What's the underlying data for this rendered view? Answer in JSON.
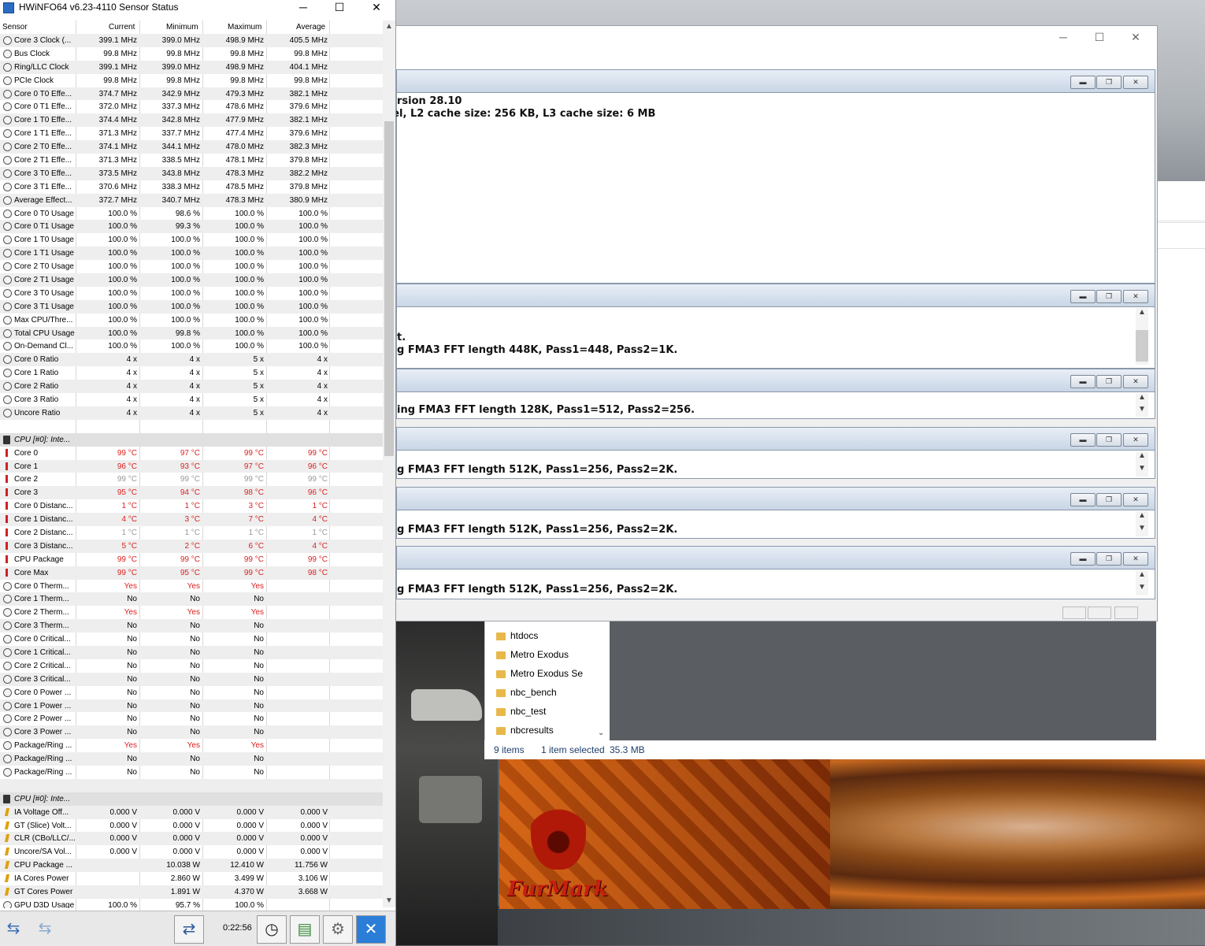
{
  "hwinfo": {
    "title": "HWiNFO64 v6.23-4110 Sensor Status",
    "columns": [
      "Sensor",
      "Current",
      "Minimum",
      "Maximum",
      "Average"
    ],
    "rows": [
      {
        "icon": "clock",
        "name": "Core 3 Clock (...",
        "cur": "399.1 MHz",
        "min": "399.0 MHz",
        "max": "498.9 MHz",
        "avg": "405.5 MHz"
      },
      {
        "icon": "clock",
        "name": "Bus Clock",
        "cur": "99.8 MHz",
        "min": "99.8 MHz",
        "max": "99.8 MHz",
        "avg": "99.8 MHz"
      },
      {
        "icon": "clock",
        "name": "Ring/LLC Clock",
        "cur": "399.1 MHz",
        "min": "399.0 MHz",
        "max": "498.9 MHz",
        "avg": "404.1 MHz"
      },
      {
        "icon": "clock",
        "name": "PCIe Clock",
        "cur": "99.8 MHz",
        "min": "99.8 MHz",
        "max": "99.8 MHz",
        "avg": "99.8 MHz"
      },
      {
        "icon": "clock",
        "name": "Core 0 T0 Effe...",
        "cur": "374.7 MHz",
        "min": "342.9 MHz",
        "max": "479.3 MHz",
        "avg": "382.1 MHz"
      },
      {
        "icon": "clock",
        "name": "Core 0 T1 Effe...",
        "cur": "372.0 MHz",
        "min": "337.3 MHz",
        "max": "478.6 MHz",
        "avg": "379.6 MHz"
      },
      {
        "icon": "clock",
        "name": "Core 1 T0 Effe...",
        "cur": "374.4 MHz",
        "min": "342.8 MHz",
        "max": "477.9 MHz",
        "avg": "382.1 MHz"
      },
      {
        "icon": "clock",
        "name": "Core 1 T1 Effe...",
        "cur": "371.3 MHz",
        "min": "337.7 MHz",
        "max": "477.4 MHz",
        "avg": "379.6 MHz"
      },
      {
        "icon": "clock",
        "name": "Core 2 T0 Effe...",
        "cur": "374.1 MHz",
        "min": "344.1 MHz",
        "max": "478.0 MHz",
        "avg": "382.3 MHz"
      },
      {
        "icon": "clock",
        "name": "Core 2 T1 Effe...",
        "cur": "371.3 MHz",
        "min": "338.5 MHz",
        "max": "478.1 MHz",
        "avg": "379.8 MHz"
      },
      {
        "icon": "clock",
        "name": "Core 3 T0 Effe...",
        "cur": "373.5 MHz",
        "min": "343.8 MHz",
        "max": "478.3 MHz",
        "avg": "382.2 MHz"
      },
      {
        "icon": "clock",
        "name": "Core 3 T1 Effe...",
        "cur": "370.6 MHz",
        "min": "338.3 MHz",
        "max": "478.5 MHz",
        "avg": "379.8 MHz"
      },
      {
        "icon": "clock",
        "name": "Average Effect...",
        "cur": "372.7 MHz",
        "min": "340.7 MHz",
        "max": "478.3 MHz",
        "avg": "380.9 MHz"
      },
      {
        "icon": "clock",
        "name": "Core 0 T0 Usage",
        "cur": "100.0 %",
        "min": "98.6 %",
        "max": "100.0 %",
        "avg": "100.0 %"
      },
      {
        "icon": "clock",
        "name": "Core 0 T1 Usage",
        "cur": "100.0 %",
        "min": "99.3 %",
        "max": "100.0 %",
        "avg": "100.0 %"
      },
      {
        "icon": "clock",
        "name": "Core 1 T0 Usage",
        "cur": "100.0 %",
        "min": "100.0 %",
        "max": "100.0 %",
        "avg": "100.0 %"
      },
      {
        "icon": "clock",
        "name": "Core 1 T1 Usage",
        "cur": "100.0 %",
        "min": "100.0 %",
        "max": "100.0 %",
        "avg": "100.0 %"
      },
      {
        "icon": "clock",
        "name": "Core 2 T0 Usage",
        "cur": "100.0 %",
        "min": "100.0 %",
        "max": "100.0 %",
        "avg": "100.0 %"
      },
      {
        "icon": "clock",
        "name": "Core 2 T1 Usage",
        "cur": "100.0 %",
        "min": "100.0 %",
        "max": "100.0 %",
        "avg": "100.0 %"
      },
      {
        "icon": "clock",
        "name": "Core 3 T0 Usage",
        "cur": "100.0 %",
        "min": "100.0 %",
        "max": "100.0 %",
        "avg": "100.0 %"
      },
      {
        "icon": "clock",
        "name": "Core 3 T1 Usage",
        "cur": "100.0 %",
        "min": "100.0 %",
        "max": "100.0 %",
        "avg": "100.0 %"
      },
      {
        "icon": "clock",
        "name": "Max CPU/Thre...",
        "cur": "100.0 %",
        "min": "100.0 %",
        "max": "100.0 %",
        "avg": "100.0 %"
      },
      {
        "icon": "clock",
        "name": "Total CPU Usage",
        "cur": "100.0 %",
        "min": "99.8 %",
        "max": "100.0 %",
        "avg": "100.0 %"
      },
      {
        "icon": "clock",
        "name": "On-Demand Cl...",
        "cur": "100.0 %",
        "min": "100.0 %",
        "max": "100.0 %",
        "avg": "100.0 %"
      },
      {
        "icon": "clock",
        "name": "Core 0 Ratio",
        "cur": "4 x",
        "min": "4 x",
        "max": "5 x",
        "avg": "4 x"
      },
      {
        "icon": "clock",
        "name": "Core 1 Ratio",
        "cur": "4 x",
        "min": "4 x",
        "max": "5 x",
        "avg": "4 x"
      },
      {
        "icon": "clock",
        "name": "Core 2 Ratio",
        "cur": "4 x",
        "min": "4 x",
        "max": "5 x",
        "avg": "4 x"
      },
      {
        "icon": "clock",
        "name": "Core 3 Ratio",
        "cur": "4 x",
        "min": "4 x",
        "max": "5 x",
        "avg": "4 x"
      },
      {
        "icon": "clock",
        "name": "Uncore Ratio",
        "cur": "4 x",
        "min": "4 x",
        "max": "5 x",
        "avg": "4 x"
      },
      {
        "icon": "none",
        "name": "",
        "cur": "",
        "min": "",
        "max": "",
        "avg": ""
      },
      {
        "icon": "cpu",
        "name": "CPU [#0]: Inte...",
        "cur": "",
        "min": "",
        "max": "",
        "avg": "",
        "group": true
      },
      {
        "icon": "temp",
        "name": "Core 0",
        "cur": "99 °C",
        "min": "97 °C",
        "max": "99 °C",
        "avg": "99 °C",
        "hot": true
      },
      {
        "icon": "temp",
        "name": "Core 1",
        "cur": "96 °C",
        "min": "93 °C",
        "max": "97 °C",
        "avg": "96 °C",
        "hot": true
      },
      {
        "icon": "temp",
        "name": "Core 2",
        "cur": "99 °C",
        "min": "99 °C",
        "max": "99 °C",
        "avg": "99 °C",
        "gray": true
      },
      {
        "icon": "temp",
        "name": "Core 3",
        "cur": "95 °C",
        "min": "94 °C",
        "max": "98 °C",
        "avg": "96 °C",
        "hot": true
      },
      {
        "icon": "temp",
        "name": "Core 0 Distanc...",
        "cur": "1 °C",
        "min": "1 °C",
        "max": "3 °C",
        "avg": "1 °C",
        "hot": true
      },
      {
        "icon": "temp",
        "name": "Core 1 Distanc...",
        "cur": "4 °C",
        "min": "3 °C",
        "max": "7 °C",
        "avg": "4 °C",
        "hot": true
      },
      {
        "icon": "temp",
        "name": "Core 2 Distanc...",
        "cur": "1 °C",
        "min": "1 °C",
        "max": "1 °C",
        "avg": "1 °C",
        "gray": true
      },
      {
        "icon": "temp",
        "name": "Core 3 Distanc...",
        "cur": "5 °C",
        "min": "2 °C",
        "max": "6 °C",
        "avg": "4 °C",
        "hot": true
      },
      {
        "icon": "temp",
        "name": "CPU Package",
        "cur": "99 °C",
        "min": "99 °C",
        "max": "99 °C",
        "avg": "99 °C",
        "hot": true
      },
      {
        "icon": "temp",
        "name": "Core Max",
        "cur": "99 °C",
        "min": "95 °C",
        "max": "99 °C",
        "avg": "98 °C",
        "hot": true
      },
      {
        "icon": "clock",
        "name": "Core 0 Therm...",
        "cur": "Yes",
        "min": "Yes",
        "max": "Yes",
        "avg": "",
        "hot": true
      },
      {
        "icon": "clock",
        "name": "Core 1 Therm...",
        "cur": "No",
        "min": "No",
        "max": "No",
        "avg": ""
      },
      {
        "icon": "clock",
        "name": "Core 2 Therm...",
        "cur": "Yes",
        "min": "Yes",
        "max": "Yes",
        "avg": "",
        "hot": true
      },
      {
        "icon": "clock",
        "name": "Core 3 Therm...",
        "cur": "No",
        "min": "No",
        "max": "No",
        "avg": ""
      },
      {
        "icon": "clock",
        "name": "Core 0 Critical...",
        "cur": "No",
        "min": "No",
        "max": "No",
        "avg": ""
      },
      {
        "icon": "clock",
        "name": "Core 1 Critical...",
        "cur": "No",
        "min": "No",
        "max": "No",
        "avg": ""
      },
      {
        "icon": "clock",
        "name": "Core 2 Critical...",
        "cur": "No",
        "min": "No",
        "max": "No",
        "avg": ""
      },
      {
        "icon": "clock",
        "name": "Core 3 Critical...",
        "cur": "No",
        "min": "No",
        "max": "No",
        "avg": ""
      },
      {
        "icon": "clock",
        "name": "Core 0 Power ...",
        "cur": "No",
        "min": "No",
        "max": "No",
        "avg": ""
      },
      {
        "icon": "clock",
        "name": "Core 1 Power ...",
        "cur": "No",
        "min": "No",
        "max": "No",
        "avg": ""
      },
      {
        "icon": "clock",
        "name": "Core 2 Power ...",
        "cur": "No",
        "min": "No",
        "max": "No",
        "avg": ""
      },
      {
        "icon": "clock",
        "name": "Core 3 Power ...",
        "cur": "No",
        "min": "No",
        "max": "No",
        "avg": ""
      },
      {
        "icon": "clock",
        "name": "Package/Ring ...",
        "cur": "Yes",
        "min": "Yes",
        "max": "Yes",
        "avg": "",
        "hot": true
      },
      {
        "icon": "clock",
        "name": "Package/Ring ...",
        "cur": "No",
        "min": "No",
        "max": "No",
        "avg": ""
      },
      {
        "icon": "clock",
        "name": "Package/Ring ...",
        "cur": "No",
        "min": "No",
        "max": "No",
        "avg": ""
      },
      {
        "icon": "none",
        "name": "",
        "cur": "",
        "min": "",
        "max": "",
        "avg": ""
      },
      {
        "icon": "cpu",
        "name": "CPU [#0]: Inte...",
        "cur": "",
        "min": "",
        "max": "",
        "avg": "",
        "group": true
      },
      {
        "icon": "volt",
        "name": "IA Voltage Off...",
        "cur": "0.000 V",
        "min": "0.000 V",
        "max": "0.000 V",
        "avg": "0.000 V"
      },
      {
        "icon": "volt",
        "name": "GT (Slice) Volt...",
        "cur": "0.000 V",
        "min": "0.000 V",
        "max": "0.000 V",
        "avg": "0.000 V"
      },
      {
        "icon": "volt",
        "name": "CLR (CBo/LLC/...",
        "cur": "0.000 V",
        "min": "0.000 V",
        "max": "0.000 V",
        "avg": "0.000 V"
      },
      {
        "icon": "volt",
        "name": "Uncore/SA Vol...",
        "cur": "0.000 V",
        "min": "0.000 V",
        "max": "0.000 V",
        "avg": "0.000 V"
      },
      {
        "icon": "volt",
        "name": "CPU Package ...",
        "cur": "",
        "min": "10.038 W",
        "max": "12.410 W",
        "avg": "11.756 W"
      },
      {
        "icon": "volt",
        "name": "IA Cores Power",
        "cur": "",
        "min": "2.860 W",
        "max": "3.499 W",
        "avg": "3.106 W"
      },
      {
        "icon": "volt",
        "name": "GT Cores Power",
        "cur": "",
        "min": "1.891 W",
        "max": "4.370 W",
        "avg": "3.668 W"
      },
      {
        "icon": "clock",
        "name": "GPU D3D Usage",
        "cur": "100.0 %",
        "min": "95.7 %",
        "max": "100.0 %",
        "avg": ""
      }
    ],
    "timer": "0:22:56"
  },
  "prime95": {
    "windows": [
      {
        "lines": [
          "rsion 28.10",
          "tel, L2 cache size: 256 KB, L3 cache size: 6 MB"
        ]
      },
      {
        "lines": [
          "t.",
          "g FMA3 FFT length 448K, Pass1=448, Pass2=1K."
        ]
      },
      {
        "lines": [
          "ing FMA3 FFT length 128K, Pass1=512, Pass2=256."
        ]
      },
      {
        "lines": [
          "g FMA3 FFT length 512K, Pass1=256, Pass2=2K."
        ]
      },
      {
        "lines": [
          "g FMA3 FFT length 512K, Pass1=256, Pass2=2K."
        ]
      },
      {
        "lines": [
          "g FMA3 FFT length 512K, Pass1=256, Pass2=2K."
        ]
      }
    ]
  },
  "explorer": {
    "items": [
      "htdocs",
      "Metro Exodus",
      "Metro Exodus Se",
      "nbc_bench",
      "nbc_test",
      "nbcresults"
    ],
    "status_count": "9 items",
    "status_selected": "1 item selected",
    "status_size": "35.3 MB"
  },
  "furmark": {
    "logo_text": "FurMark"
  }
}
